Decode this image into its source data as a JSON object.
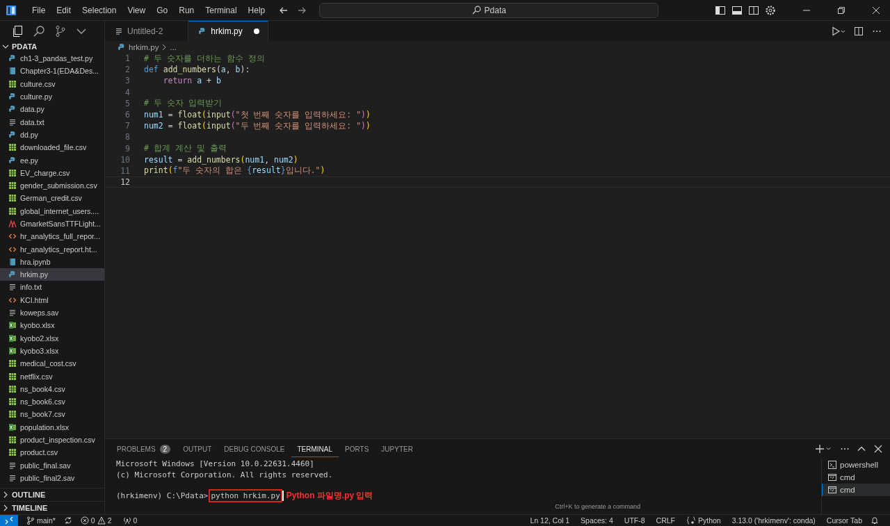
{
  "menu": [
    "File",
    "Edit",
    "Selection",
    "View",
    "Go",
    "Run",
    "Terminal",
    "Help"
  ],
  "command_center": {
    "value": "Pdata"
  },
  "explorer": {
    "title": "PDATA",
    "expanded": true,
    "files": [
      {
        "name": "ch1-3_pandas_test.py",
        "kind": "py",
        "selected": false
      },
      {
        "name": "Chapter3-1(EDA&Des...",
        "kind": "ipynb",
        "selected": false
      },
      {
        "name": "culture.csv",
        "kind": "csv",
        "selected": false
      },
      {
        "name": "culture.py",
        "kind": "py",
        "selected": false
      },
      {
        "name": "data.py",
        "kind": "py",
        "selected": false
      },
      {
        "name": "data.txt",
        "kind": "txt",
        "selected": false
      },
      {
        "name": "dd.py",
        "kind": "py",
        "selected": false
      },
      {
        "name": "downloaded_file.csv",
        "kind": "csv",
        "selected": false
      },
      {
        "name": "ee.py",
        "kind": "py",
        "selected": false
      },
      {
        "name": "EV_charge.csv",
        "kind": "csv",
        "selected": false
      },
      {
        "name": "gender_submission.csv",
        "kind": "csv",
        "selected": false
      },
      {
        "name": "German_credit.csv",
        "kind": "csv",
        "selected": false
      },
      {
        "name": "global_internet_users....",
        "kind": "csv",
        "selected": false
      },
      {
        "name": "GmarketSansTTFLight...",
        "kind": "font",
        "selected": false
      },
      {
        "name": "hr_analytics_full_repor...",
        "kind": "html",
        "selected": false
      },
      {
        "name": "hr_analytics_report.ht...",
        "kind": "html",
        "selected": false
      },
      {
        "name": "hra.ipynb",
        "kind": "ipynb",
        "selected": false
      },
      {
        "name": "hrkim.py",
        "kind": "py",
        "selected": true
      },
      {
        "name": "info.txt",
        "kind": "txt",
        "selected": false
      },
      {
        "name": "KCI.html",
        "kind": "html",
        "selected": false
      },
      {
        "name": "koweps.sav",
        "kind": "txt",
        "selected": false
      },
      {
        "name": "kyobo.xlsx",
        "kind": "xlsx",
        "selected": false
      },
      {
        "name": "kyobo2.xlsx",
        "kind": "xlsx",
        "selected": false
      },
      {
        "name": "kyobo3.xlsx",
        "kind": "xlsx",
        "selected": false
      },
      {
        "name": "medical_cost.csv",
        "kind": "csv",
        "selected": false
      },
      {
        "name": "netflix.csv",
        "kind": "csv",
        "selected": false
      },
      {
        "name": "ns_book4.csv",
        "kind": "csv",
        "selected": false
      },
      {
        "name": "ns_book6.csv",
        "kind": "csv",
        "selected": false
      },
      {
        "name": "ns_book7.csv",
        "kind": "csv",
        "selected": false
      },
      {
        "name": "population.xlsx",
        "kind": "xlsx",
        "selected": false
      },
      {
        "name": "product_inspection.csv",
        "kind": "csv",
        "selected": false
      },
      {
        "name": "product.csv",
        "kind": "csv",
        "selected": false
      },
      {
        "name": "public_final.sav",
        "kind": "txt",
        "selected": false
      },
      {
        "name": "public_final2.sav",
        "kind": "txt",
        "selected": false
      }
    ]
  },
  "sections": [
    {
      "title": "OUTLINE",
      "expanded": false
    },
    {
      "title": "TIMELINE",
      "expanded": false
    }
  ],
  "tabs": [
    {
      "label": "Untitled-2",
      "kind": "txt",
      "selected": false,
      "modified": false
    },
    {
      "label": "hrkim.py",
      "kind": "py",
      "selected": true,
      "modified": true
    }
  ],
  "breadcrumb": {
    "file": "hrkim.py",
    "rest": "..."
  },
  "code": {
    "lines": [
      {
        "number": "1",
        "current": false,
        "tokens": [
          {
            "text": "# 두 숫자를 더하는 함수 정의",
            "kind": "comment"
          }
        ]
      },
      {
        "number": "2",
        "current": false,
        "tokens": [
          {
            "text": "def ",
            "kind": "keyword"
          },
          {
            "text": "add_numbers",
            "kind": "function"
          },
          {
            "text": "(",
            "kind": "plain"
          },
          {
            "text": "a",
            "kind": "variable"
          },
          {
            "text": ", ",
            "kind": "plain"
          },
          {
            "text": "b",
            "kind": "variable"
          },
          {
            "text": "):",
            "kind": "plain"
          }
        ]
      },
      {
        "number": "3",
        "current": false,
        "indented": true,
        "tokens": [
          {
            "text": "return ",
            "kind": "control"
          },
          {
            "text": "a",
            "kind": "variable"
          },
          {
            "text": " + ",
            "kind": "plain"
          },
          {
            "text": "b",
            "kind": "variable"
          }
        ]
      },
      {
        "number": "4",
        "current": false
      },
      {
        "number": "5",
        "current": false,
        "tokens": [
          {
            "text": "# 두 숫자 입력받기",
            "kind": "comment"
          }
        ]
      },
      {
        "number": "6",
        "current": false,
        "tokens": [
          {
            "text": "num1",
            "kind": "variable"
          },
          {
            "text": " = ",
            "kind": "plain"
          },
          {
            "text": "float",
            "kind": "function"
          },
          {
            "text": "(",
            "kind": "bracket"
          },
          {
            "text": "input",
            "kind": "function"
          },
          {
            "text": "(",
            "kind": "bracket2"
          },
          {
            "text": "\"첫 번째 숫자를 입력하세요: \"",
            "kind": "string"
          },
          {
            "text": ")",
            "kind": "bracket2"
          },
          {
            "text": ")",
            "kind": "bracket"
          }
        ]
      },
      {
        "number": "7",
        "current": false,
        "tokens": [
          {
            "text": "num2",
            "kind": "variable"
          },
          {
            "text": " = ",
            "kind": "plain"
          },
          {
            "text": "float",
            "kind": "function"
          },
          {
            "text": "(",
            "kind": "bracket"
          },
          {
            "text": "input",
            "kind": "function"
          },
          {
            "text": "(",
            "kind": "bracket2"
          },
          {
            "text": "\"두 번째 숫자를 입력하세요: \"",
            "kind": "string"
          },
          {
            "text": ")",
            "kind": "bracket2"
          },
          {
            "text": ")",
            "kind": "bracket"
          }
        ]
      },
      {
        "number": "8",
        "current": false
      },
      {
        "number": "9",
        "current": false,
        "tokens": [
          {
            "text": "# 합계 계산 및 출력",
            "kind": "comment"
          }
        ]
      },
      {
        "number": "10",
        "current": false,
        "tokens": [
          {
            "text": "result",
            "kind": "variable"
          },
          {
            "text": " = ",
            "kind": "plain"
          },
          {
            "text": "add_numbers",
            "kind": "function"
          },
          {
            "text": "(",
            "kind": "bracket"
          },
          {
            "text": "num1",
            "kind": "variable"
          },
          {
            "text": ", ",
            "kind": "plain"
          },
          {
            "text": "num2",
            "kind": "variable"
          },
          {
            "text": ")",
            "kind": "bracket"
          }
        ]
      },
      {
        "number": "11",
        "current": false,
        "tokens": [
          {
            "text": "print",
            "kind": "function"
          },
          {
            "text": "(",
            "kind": "bracket"
          },
          {
            "text": "f",
            "kind": "keyword"
          },
          {
            "text": "\"두 숫자의 합은 ",
            "kind": "string"
          },
          {
            "text": "{",
            "kind": "keyword"
          },
          {
            "text": "result",
            "kind": "variable"
          },
          {
            "text": "}",
            "kind": "keyword"
          },
          {
            "text": "입니다.\"",
            "kind": "string"
          },
          {
            "text": ")",
            "kind": "bracket"
          }
        ]
      },
      {
        "number": "12",
        "current": true
      }
    ]
  },
  "panel": {
    "tabs": [
      {
        "label": "PROBLEMS",
        "badge": "2",
        "selected": false
      },
      {
        "label": "OUTPUT",
        "selected": false
      },
      {
        "label": "DEBUG CONSOLE",
        "selected": false
      },
      {
        "label": "TERMINAL",
        "selected": true
      },
      {
        "label": "PORTS",
        "selected": false
      },
      {
        "label": "JUPYTER",
        "selected": false
      }
    ],
    "terminal_lines": [
      "Microsoft Windows [Version 10.0.22631.4460]",
      "(c) Microsoft Corporation. All rights reserved."
    ],
    "prompt": "(hrkimenv) C:\\Pdata>",
    "command": "python hrkim.py",
    "annotation": "Python 파일명.py 입력",
    "hint": "Ctrl+K to generate a command",
    "terminals": [
      {
        "name": "powershell",
        "kind": "powershell",
        "selected": false
      },
      {
        "name": "cmd",
        "kind": "cmd",
        "selected": false
      },
      {
        "name": "cmd",
        "kind": "cmd",
        "selected": true
      }
    ]
  },
  "status_bar": {
    "branch": "main*",
    "errors": "0",
    "warnings": "2",
    "ports": "0",
    "right": [
      {
        "text": "Ln 12, Col 1"
      },
      {
        "text": "Spaces: 4"
      },
      {
        "text": "UTF-8"
      },
      {
        "text": "CRLF"
      },
      {
        "text": "Python",
        "kind": "language"
      },
      {
        "text": "3.13.0 ('hrkimenv': conda)"
      },
      {
        "text": "Cursor Tab"
      }
    ]
  }
}
